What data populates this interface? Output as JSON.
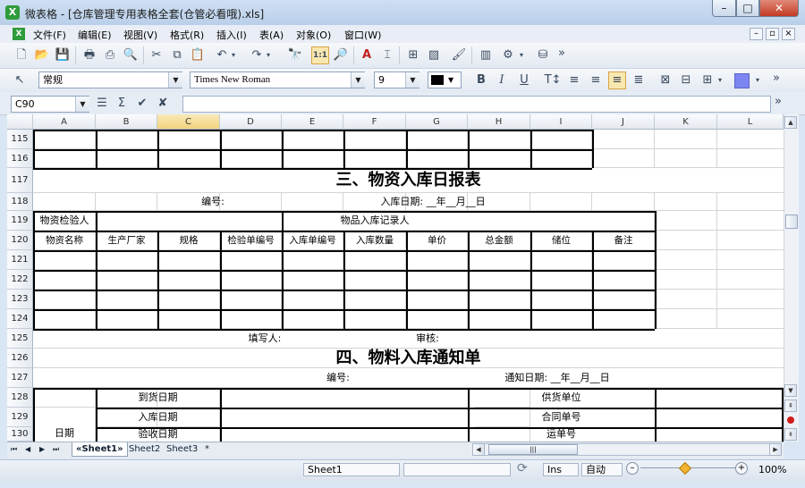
{
  "window": {
    "app_icon_glyph": "X",
    "title": "微表格 - [仓库管理专用表格全套(仓管必看哦).xls]"
  },
  "menu": [
    "文件(F)",
    "编辑(E)",
    "视图(V)",
    "格式(R)",
    "插入(I)",
    "表(A)",
    "对象(O)",
    "窗口(W)"
  ],
  "format_bar": {
    "style": "常规",
    "font": "Times New Roman",
    "size": "9"
  },
  "formula_bar": {
    "cell_ref": "C90",
    "content": ""
  },
  "columns": [
    "A",
    "B",
    "C",
    "D",
    "E",
    "F",
    "G",
    "H",
    "I",
    "J",
    "K",
    "L"
  ],
  "selected_column": "C",
  "rows": [
    "115",
    "116",
    "117",
    "118",
    "119",
    "120",
    "121",
    "122",
    "123",
    "124",
    "125",
    "126",
    "127",
    "128",
    "129",
    "130"
  ],
  "sheet": {
    "title1": "三、物资入库日报表",
    "r118_no": "编号:",
    "r118_date": "入库日期: __年__月__日",
    "r119_inspector": "物资检验人",
    "r119_recorder": "物品入库记录人",
    "r120_headers": [
      "物资名称",
      "生产厂家",
      "规格",
      "检验单编号",
      "入库单编号",
      "入库数量",
      "单价",
      "总金额",
      "储位",
      "备注"
    ],
    "r125_filler": "填写人:",
    "r125_review": "审核:",
    "title2": "四、物料入库通知单",
    "r127_no": "编号:",
    "r127_date": "通知日期: __年__月__日",
    "r128_arrival": "到货日期",
    "r128_supplier": "供货单位",
    "r129_instock": "入库日期",
    "r129_contract": "合同单号",
    "r130_date": "日期",
    "r130_accept": "验收日期",
    "r130_waybill": "运单号"
  },
  "sheet_tabs": {
    "active": "«Sheet1»",
    "tabs": [
      "Sheet2",
      "Sheet3",
      "*"
    ]
  },
  "status": {
    "sheet": "Sheet1",
    "mode": "Ins",
    "calc": "自动",
    "zoom": "100%"
  }
}
